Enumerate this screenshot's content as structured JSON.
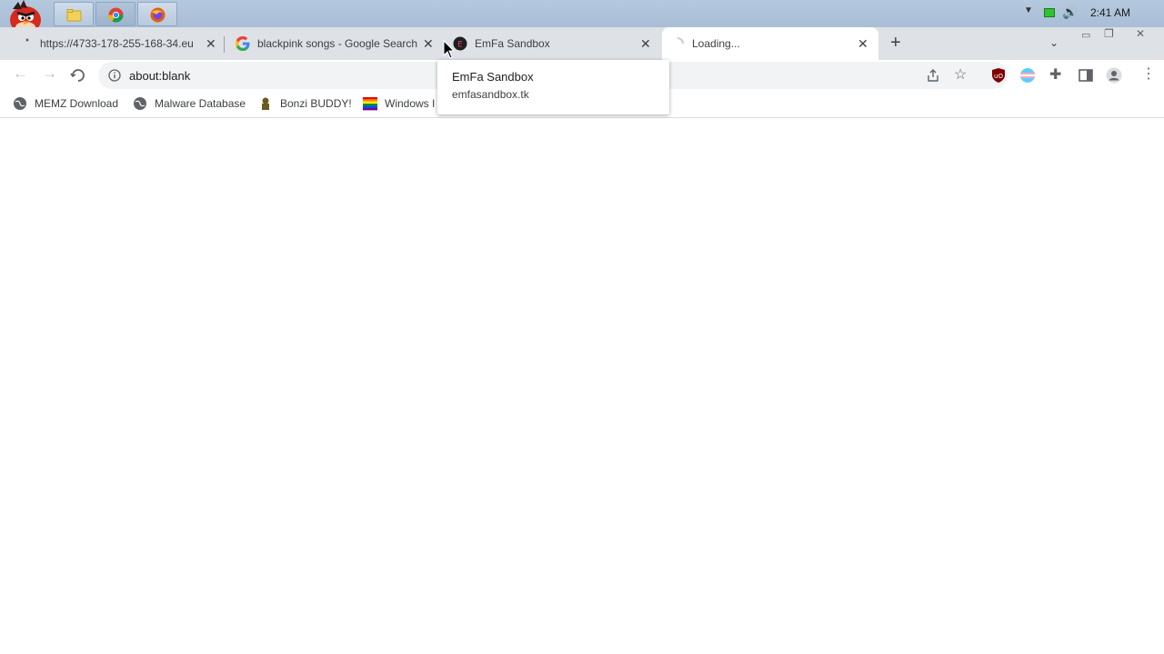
{
  "taskbar": {
    "buttons": [
      {
        "name": "folder-icon"
      },
      {
        "name": "chrome-icon"
      },
      {
        "name": "firefox-icon"
      }
    ],
    "clock": "2:41 AM"
  },
  "tabs": [
    {
      "title": "https://4733-178-255-168-34.eu",
      "favicon": "globe-icon"
    },
    {
      "title": "blackpink songs - Google Search",
      "favicon": "google-icon"
    },
    {
      "title": "EmFa Sandbox",
      "favicon": "emfa-icon"
    },
    {
      "title": "Loading...",
      "favicon": "spinner-icon"
    }
  ],
  "omnibox": {
    "url": "about:blank"
  },
  "bookmarks": [
    {
      "label": "MEMZ Download"
    },
    {
      "label": "Malware Database"
    },
    {
      "label": "Bonzi BUDDY!"
    },
    {
      "label": "Windows I"
    }
  ],
  "tooltip": {
    "title": "EmFa Sandbox",
    "domain": "emfasandbox.tk"
  },
  "colors": {
    "tabstrip": "#dee1e6",
    "taskbar": "#aabfd7",
    "accent_red": "#c0211b"
  }
}
